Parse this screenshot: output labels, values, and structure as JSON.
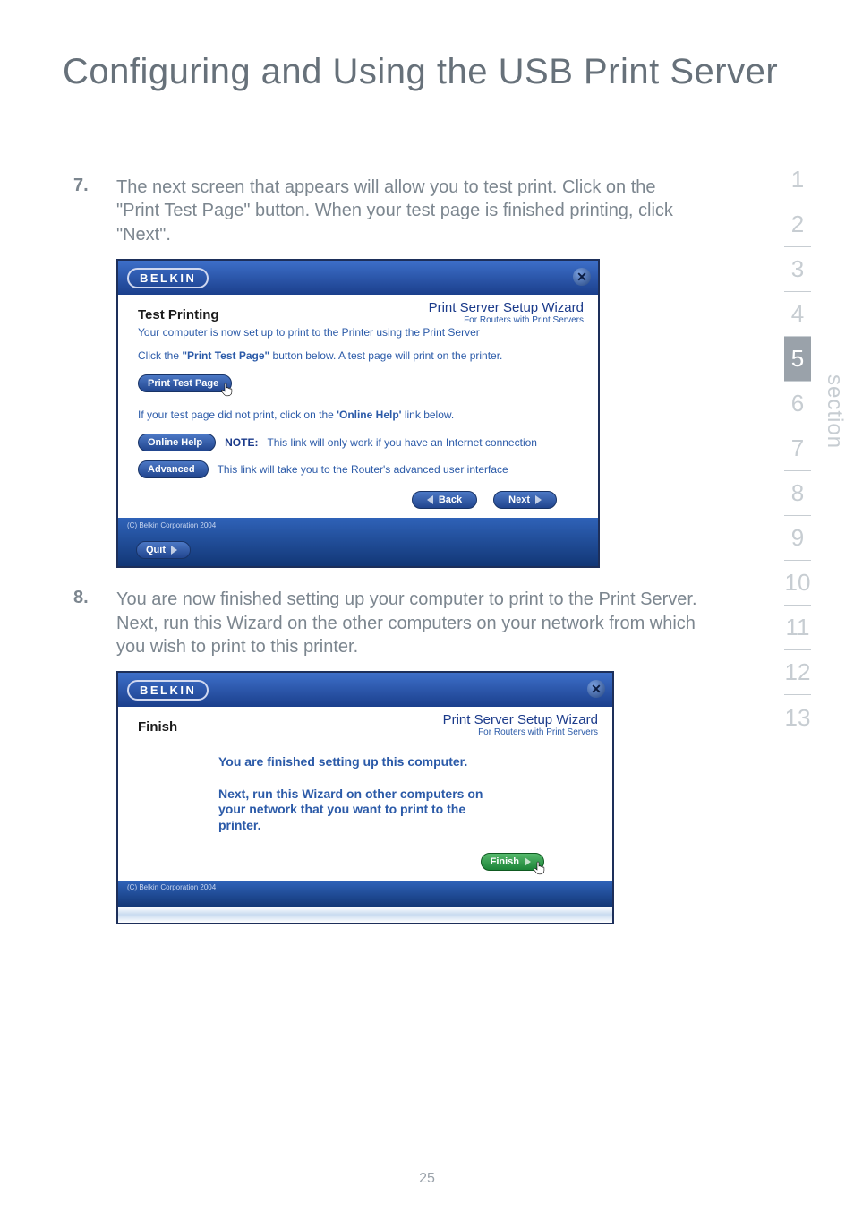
{
  "page_title": "Configuring and Using the USB Print Server",
  "page_number": "25",
  "section_label": "section",
  "sections": {
    "items": [
      "1",
      "2",
      "3",
      "4",
      "5",
      "6",
      "7",
      "8",
      "9",
      "10",
      "11",
      "12",
      "13"
    ],
    "active_index": 4
  },
  "step7": {
    "num": "7.",
    "text": "The next screen that appears will allow you to test print. Click on the \"Print Test Page\" button. When your test page is finished printing, click \"Next\"."
  },
  "step8": {
    "num": "8.",
    "text": "You are now finished setting up your computer to print to the Print Server. Next, run this Wizard on the other computers on your network from which you wish to print to this printer."
  },
  "wizard_common": {
    "logo": "BELKIN",
    "title": "Print Server Setup Wizard",
    "subtitle": "For Routers with Print Servers",
    "copyright": "(C) Belkin Corporation 2004",
    "close_label": "✕"
  },
  "screen1": {
    "heading": "Test Printing",
    "sub": "Your computer is now set up to print to the Printer using the Print Server",
    "instr_prefix": "Click the ",
    "instr_bold": "\"Print Test Page\"",
    "instr_suffix": " button below. A test page will print on the printer.",
    "print_btn": "Print Test Page",
    "help_line": "If your test page did not print, click on the ",
    "help_bold": "'Online Help'",
    "help_suffix": " link below.",
    "online_help_btn": "Online Help",
    "note_label": "NOTE:",
    "note_text": "This link will only work if you have an Internet connection",
    "advanced_btn": "Advanced",
    "advanced_text": "This link will take you to the Router's advanced user interface",
    "back_btn": "Back",
    "next_btn": "Next",
    "quit_btn": "Quit"
  },
  "screen2": {
    "heading": "Finish",
    "msg1": "You are finished setting up this computer.",
    "msg2": "Next, run this Wizard on other computers on your network that you want to print to the printer.",
    "finish_btn": "Finish"
  }
}
